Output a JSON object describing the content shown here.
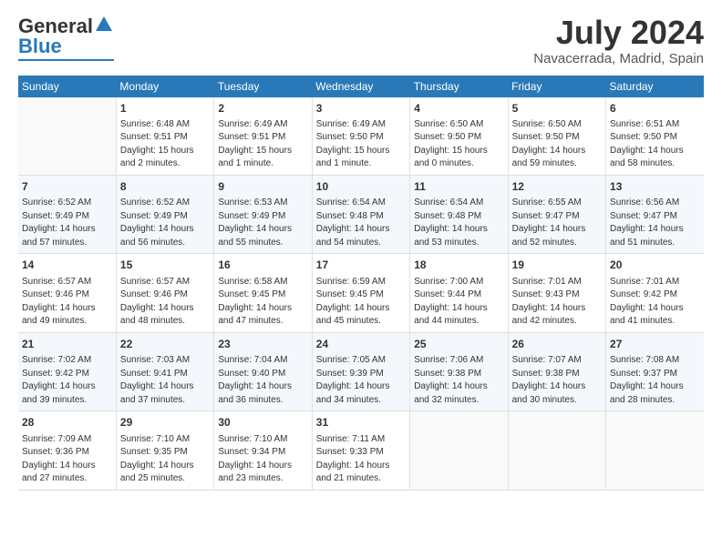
{
  "header": {
    "logo_general": "General",
    "logo_blue": "Blue",
    "month_year": "July 2024",
    "location": "Navacerrada, Madrid, Spain"
  },
  "days_of_week": [
    "Sunday",
    "Monday",
    "Tuesday",
    "Wednesday",
    "Thursday",
    "Friday",
    "Saturday"
  ],
  "weeks": [
    [
      {
        "day": "",
        "content": ""
      },
      {
        "day": "1",
        "content": "Sunrise: 6:48 AM\nSunset: 9:51 PM\nDaylight: 15 hours\nand 2 minutes."
      },
      {
        "day": "2",
        "content": "Sunrise: 6:49 AM\nSunset: 9:51 PM\nDaylight: 15 hours\nand 1 minute."
      },
      {
        "day": "3",
        "content": "Sunrise: 6:49 AM\nSunset: 9:50 PM\nDaylight: 15 hours\nand 1 minute."
      },
      {
        "day": "4",
        "content": "Sunrise: 6:50 AM\nSunset: 9:50 PM\nDaylight: 15 hours\nand 0 minutes."
      },
      {
        "day": "5",
        "content": "Sunrise: 6:50 AM\nSunset: 9:50 PM\nDaylight: 14 hours\nand 59 minutes."
      },
      {
        "day": "6",
        "content": "Sunrise: 6:51 AM\nSunset: 9:50 PM\nDaylight: 14 hours\nand 58 minutes."
      }
    ],
    [
      {
        "day": "7",
        "content": "Sunrise: 6:52 AM\nSunset: 9:49 PM\nDaylight: 14 hours\nand 57 minutes."
      },
      {
        "day": "8",
        "content": "Sunrise: 6:52 AM\nSunset: 9:49 PM\nDaylight: 14 hours\nand 56 minutes."
      },
      {
        "day": "9",
        "content": "Sunrise: 6:53 AM\nSunset: 9:49 PM\nDaylight: 14 hours\nand 55 minutes."
      },
      {
        "day": "10",
        "content": "Sunrise: 6:54 AM\nSunset: 9:48 PM\nDaylight: 14 hours\nand 54 minutes."
      },
      {
        "day": "11",
        "content": "Sunrise: 6:54 AM\nSunset: 9:48 PM\nDaylight: 14 hours\nand 53 minutes."
      },
      {
        "day": "12",
        "content": "Sunrise: 6:55 AM\nSunset: 9:47 PM\nDaylight: 14 hours\nand 52 minutes."
      },
      {
        "day": "13",
        "content": "Sunrise: 6:56 AM\nSunset: 9:47 PM\nDaylight: 14 hours\nand 51 minutes."
      }
    ],
    [
      {
        "day": "14",
        "content": "Sunrise: 6:57 AM\nSunset: 9:46 PM\nDaylight: 14 hours\nand 49 minutes."
      },
      {
        "day": "15",
        "content": "Sunrise: 6:57 AM\nSunset: 9:46 PM\nDaylight: 14 hours\nand 48 minutes."
      },
      {
        "day": "16",
        "content": "Sunrise: 6:58 AM\nSunset: 9:45 PM\nDaylight: 14 hours\nand 47 minutes."
      },
      {
        "day": "17",
        "content": "Sunrise: 6:59 AM\nSunset: 9:45 PM\nDaylight: 14 hours\nand 45 minutes."
      },
      {
        "day": "18",
        "content": "Sunrise: 7:00 AM\nSunset: 9:44 PM\nDaylight: 14 hours\nand 44 minutes."
      },
      {
        "day": "19",
        "content": "Sunrise: 7:01 AM\nSunset: 9:43 PM\nDaylight: 14 hours\nand 42 minutes."
      },
      {
        "day": "20",
        "content": "Sunrise: 7:01 AM\nSunset: 9:42 PM\nDaylight: 14 hours\nand 41 minutes."
      }
    ],
    [
      {
        "day": "21",
        "content": "Sunrise: 7:02 AM\nSunset: 9:42 PM\nDaylight: 14 hours\nand 39 minutes."
      },
      {
        "day": "22",
        "content": "Sunrise: 7:03 AM\nSunset: 9:41 PM\nDaylight: 14 hours\nand 37 minutes."
      },
      {
        "day": "23",
        "content": "Sunrise: 7:04 AM\nSunset: 9:40 PM\nDaylight: 14 hours\nand 36 minutes."
      },
      {
        "day": "24",
        "content": "Sunrise: 7:05 AM\nSunset: 9:39 PM\nDaylight: 14 hours\nand 34 minutes."
      },
      {
        "day": "25",
        "content": "Sunrise: 7:06 AM\nSunset: 9:38 PM\nDaylight: 14 hours\nand 32 minutes."
      },
      {
        "day": "26",
        "content": "Sunrise: 7:07 AM\nSunset: 9:38 PM\nDaylight: 14 hours\nand 30 minutes."
      },
      {
        "day": "27",
        "content": "Sunrise: 7:08 AM\nSunset: 9:37 PM\nDaylight: 14 hours\nand 28 minutes."
      }
    ],
    [
      {
        "day": "28",
        "content": "Sunrise: 7:09 AM\nSunset: 9:36 PM\nDaylight: 14 hours\nand 27 minutes."
      },
      {
        "day": "29",
        "content": "Sunrise: 7:10 AM\nSunset: 9:35 PM\nDaylight: 14 hours\nand 25 minutes."
      },
      {
        "day": "30",
        "content": "Sunrise: 7:10 AM\nSunset: 9:34 PM\nDaylight: 14 hours\nand 23 minutes."
      },
      {
        "day": "31",
        "content": "Sunrise: 7:11 AM\nSunset: 9:33 PM\nDaylight: 14 hours\nand 21 minutes."
      },
      {
        "day": "",
        "content": ""
      },
      {
        "day": "",
        "content": ""
      },
      {
        "day": "",
        "content": ""
      }
    ]
  ]
}
